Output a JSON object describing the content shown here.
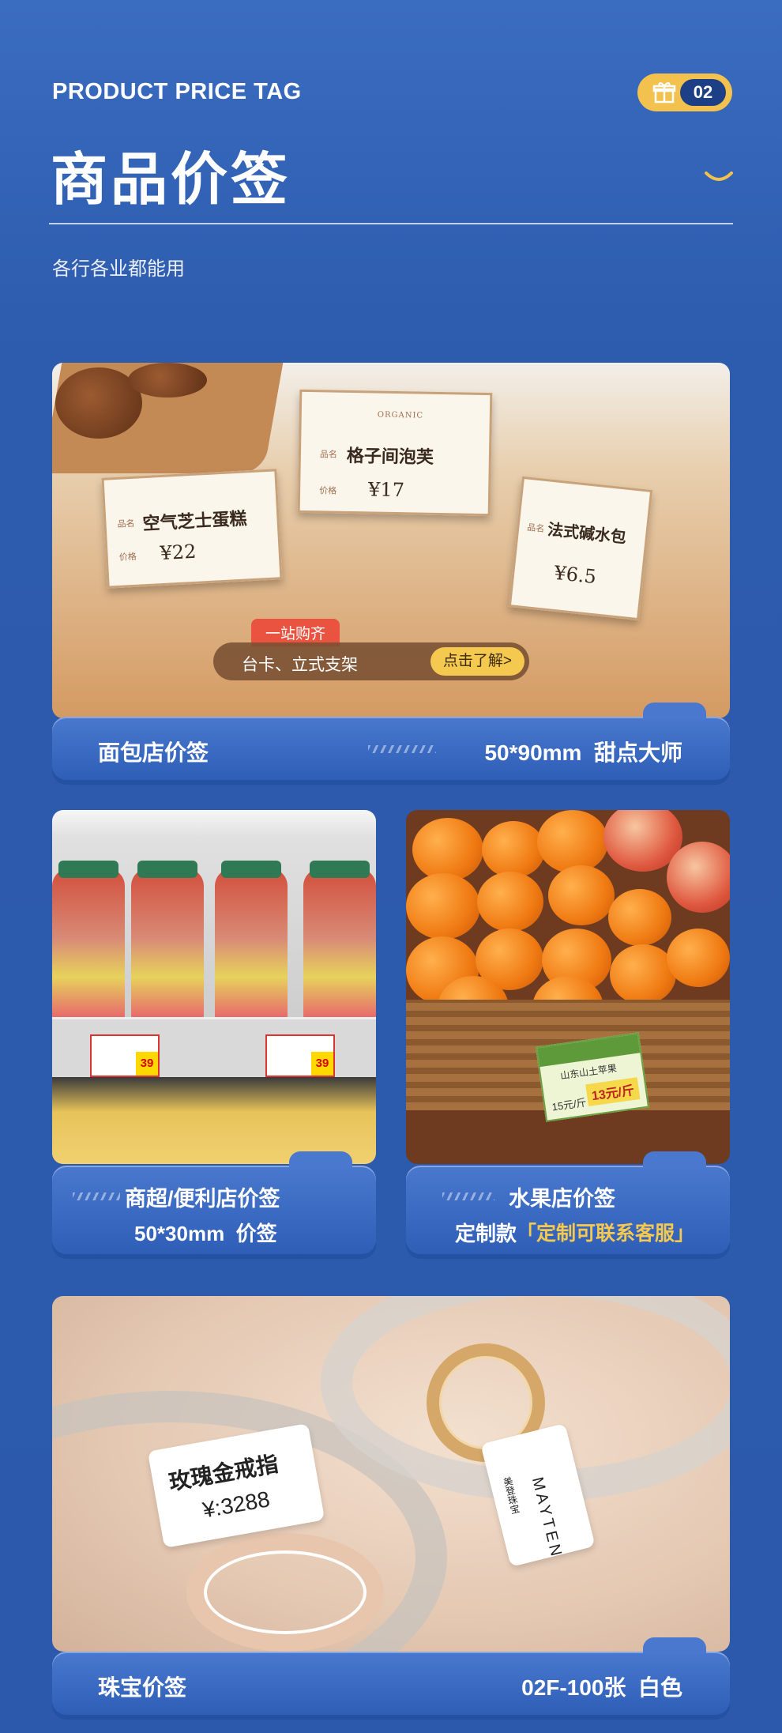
{
  "header": {
    "title_en": "PRODUCT PRICE TAG",
    "title_cn": "商品价签",
    "badge_number": "02",
    "subtitle": "各行各业都能用"
  },
  "bakery": {
    "tags": [
      {
        "name_label": "品名",
        "name": "空气芝士蛋糕",
        "price_label": "价格",
        "price": "¥22"
      },
      {
        "name_label": "品名",
        "name": "格子间泡芙",
        "price_label": "价格",
        "price": "¥17",
        "brand": "ORGANIC"
      },
      {
        "name_label": "品名",
        "name": "法式碱水包",
        "price_label": "价格",
        "price": "¥6.5"
      }
    ],
    "promo_pill": "一站购齐",
    "banner_text": "台卡、立式支架",
    "cta_label": "点击了解>",
    "bar_left": "面包店价签",
    "bar_right": "50*90mm  甜点大师"
  },
  "supermarket": {
    "tag_price": "39",
    "bar_line1": "商超/便利店价签",
    "bar_line2": "50*30mm  价签"
  },
  "fruit": {
    "tag_name": "山东山土苹果",
    "tag_price": "13元/斤",
    "tag_price_old": "15元/斤",
    "bar_line1": "水果店价签",
    "bar_line2_prefix": "定制款",
    "bar_line2_highlight": "「定制可联系客服」"
  },
  "jewelry": {
    "tag_name": "玫瑰金戒指",
    "tag_price": "¥:3288",
    "brand_tag": "MAYTEN",
    "brand_sub": "美登珠宝",
    "bar_left": "珠宝价签",
    "bar_right": "02F-100张  白色"
  },
  "colors": {
    "background": "#2c59ab",
    "badge": "#f2c14e",
    "highlight": "#f5c84f"
  }
}
